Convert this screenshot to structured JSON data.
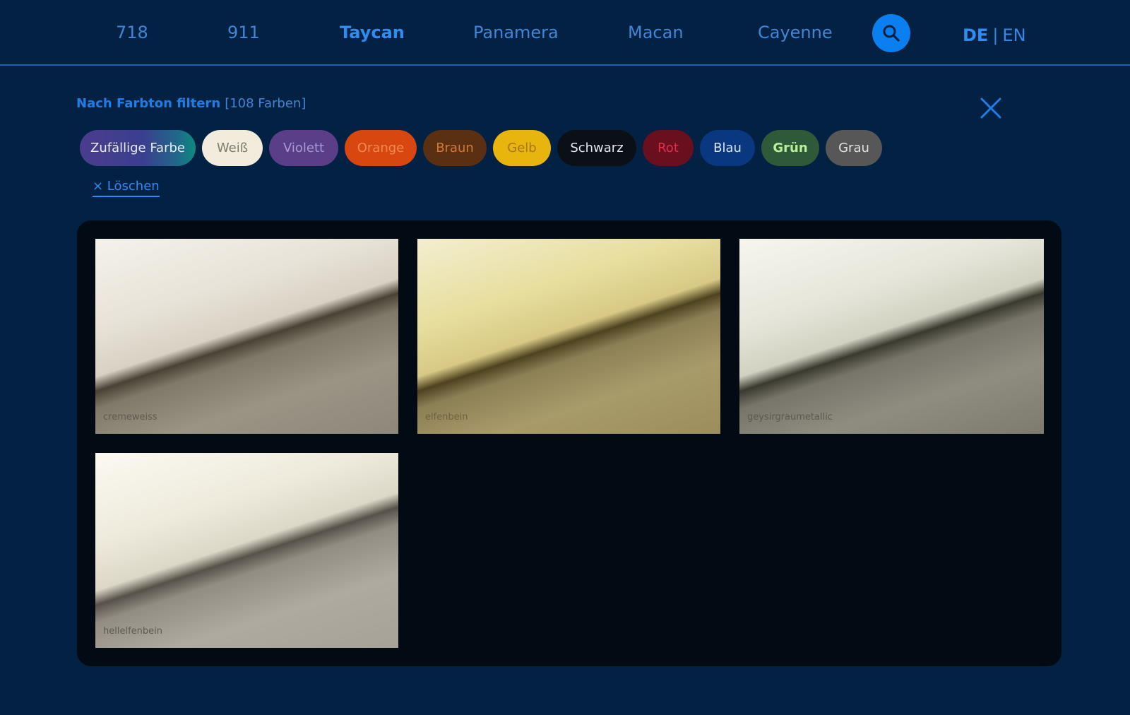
{
  "nav": {
    "items": [
      {
        "label": "718"
      },
      {
        "label": "911"
      },
      {
        "label": "Taycan",
        "active": true
      },
      {
        "label": "Panamera"
      },
      {
        "label": "Macan"
      },
      {
        "label": "Cayenne"
      }
    ],
    "search_icon": "search-icon",
    "lang": {
      "de": "DE",
      "separator": "|",
      "en": "EN"
    }
  },
  "filter": {
    "title": "Nach Farbton filtern",
    "count": "[108 Farben]",
    "close_icon": "close-icon",
    "chips": [
      {
        "label": "Zufällige Farbe"
      },
      {
        "label": "Weiß",
        "color": "#f1ecdc"
      },
      {
        "label": "Violett",
        "color": "#5a3f88"
      },
      {
        "label": "Orange",
        "color": "#d8470f"
      },
      {
        "label": "Braun",
        "color": "#5a2f12"
      },
      {
        "label": "Gelb",
        "color": "#e8b50e"
      },
      {
        "label": "Schwarz",
        "color": "#0b0f16"
      },
      {
        "label": "Rot",
        "color": "#6a0f1e"
      },
      {
        "label": "Blau",
        "color": "#0a3880"
      },
      {
        "label": "Grün",
        "color": "#2f5a3a"
      },
      {
        "label": "Grau",
        "color": "#575757"
      }
    ],
    "clear": "× Löschen"
  },
  "results": [
    {
      "name": "cremeweiss"
    },
    {
      "name": "elfenbein"
    },
    {
      "name": "geysirgraumetallic"
    },
    {
      "name": "hellelfenbein"
    }
  ],
  "colors": {
    "background": "#022143",
    "accent": "#0a7ff0",
    "panel": "#020b14"
  }
}
